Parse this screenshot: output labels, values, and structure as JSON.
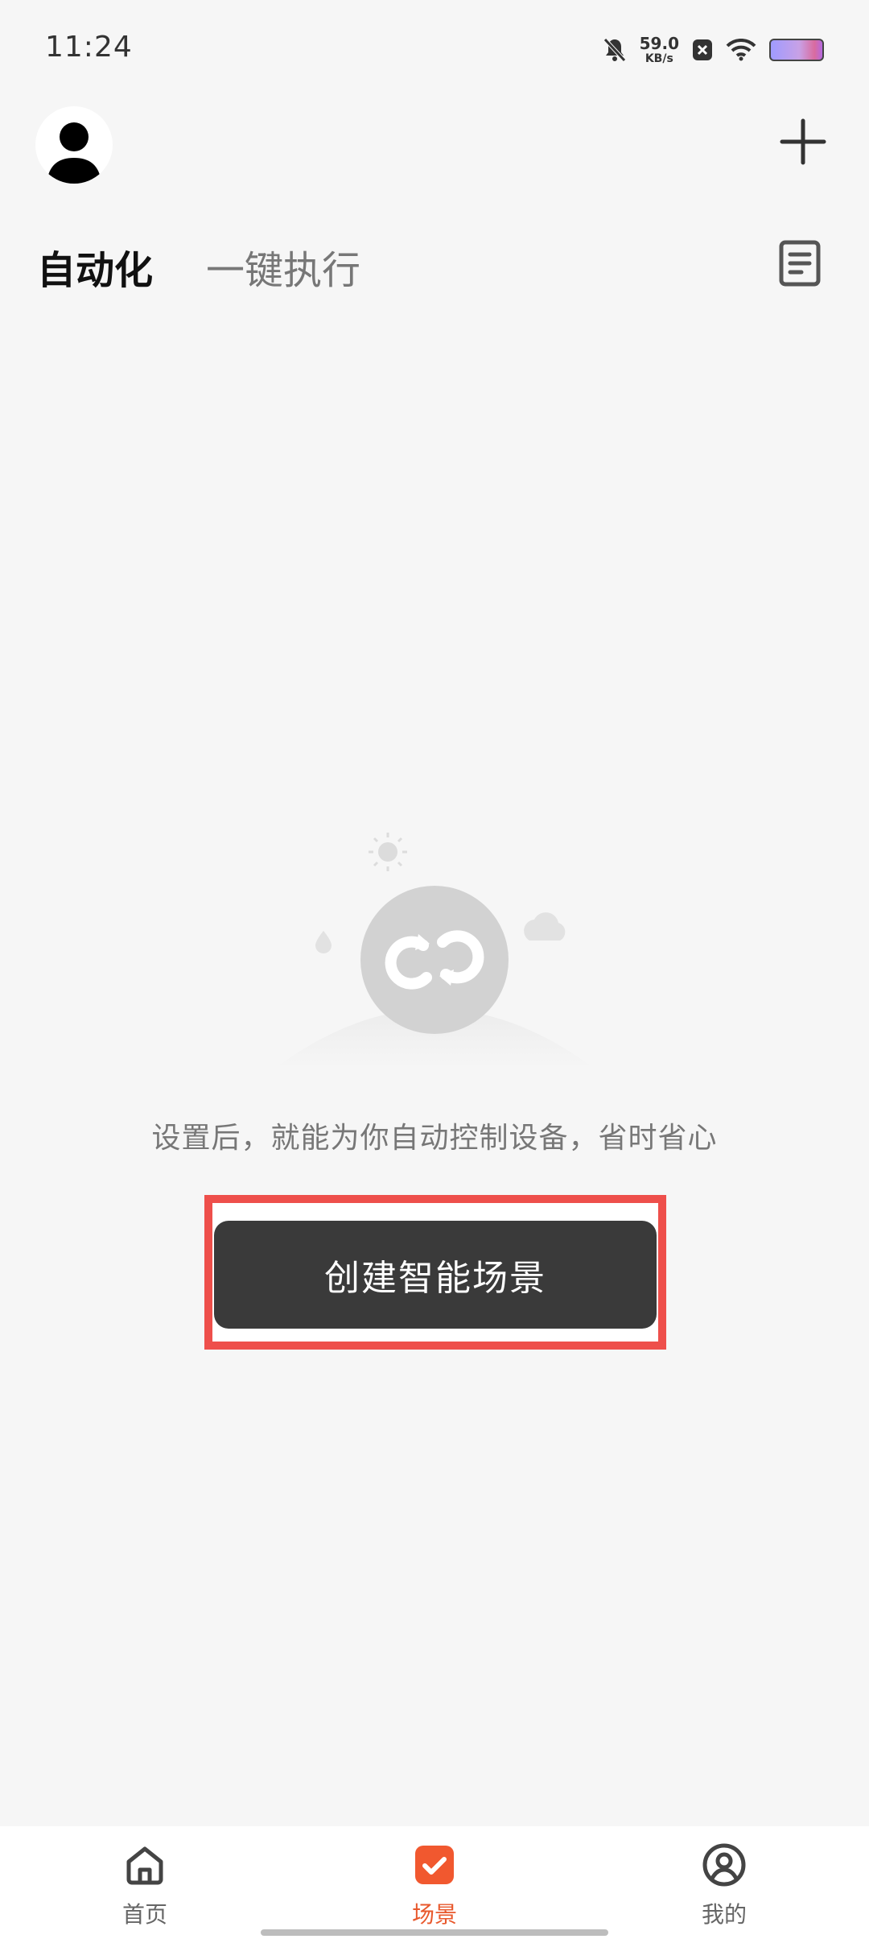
{
  "status_bar": {
    "time": "11:24",
    "net_speed_value": "59.0",
    "net_speed_unit": "KB/s",
    "icons": [
      "bell-mute-icon",
      "notification-x-icon",
      "wifi-icon",
      "battery-icon"
    ]
  },
  "header": {
    "avatar_icon": "user-avatar-icon",
    "add_icon": "plus-icon"
  },
  "tabs": [
    {
      "label": "自动化",
      "active": true
    },
    {
      "label": "一键执行",
      "active": false
    }
  ],
  "logs_icon": "document-icon",
  "empty_state": {
    "message": "设置后，就能为你自动控制设备，省时省心",
    "button_label": "创建智能场景"
  },
  "bottom_nav": [
    {
      "label": "首页",
      "icon": "home-icon",
      "active": false
    },
    {
      "label": "场景",
      "icon": "scene-check-icon",
      "active": true
    },
    {
      "label": "我的",
      "icon": "profile-icon",
      "active": false
    }
  ],
  "colors": {
    "accent": "#e8582c",
    "button_bg": "#3a3a3a",
    "highlight": "#ee4f4b"
  }
}
